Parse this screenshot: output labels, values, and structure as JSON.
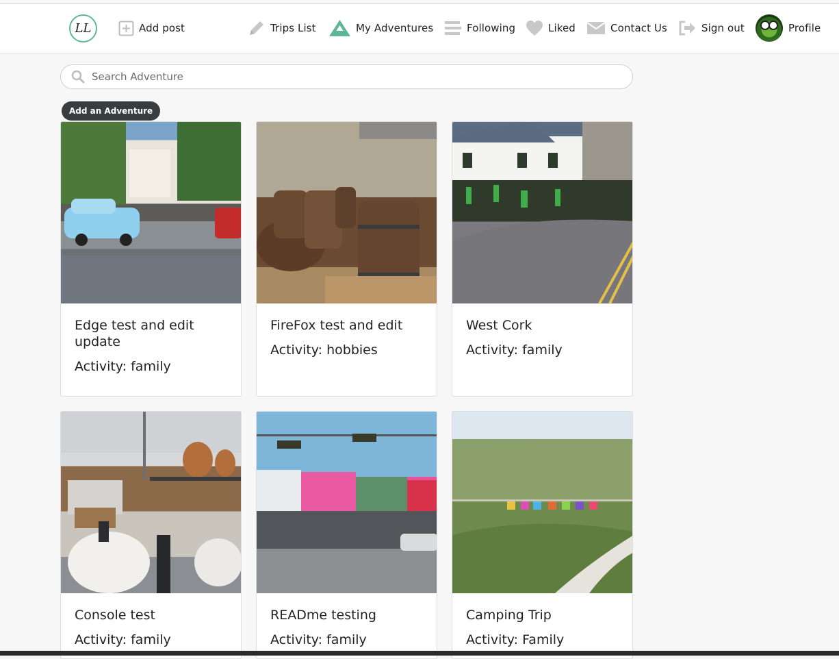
{
  "nav": {
    "logo_text": "LL",
    "add_post": "Add post",
    "trips_list": "Trips List",
    "my_adventures": "My Adventures",
    "following": "Following",
    "liked": "Liked",
    "contact_us": "Contact Us",
    "sign_out": "Sign out",
    "profile": "Profile"
  },
  "search": {
    "placeholder": "Search Adventure"
  },
  "add_adventure_label": "Add an Adventure",
  "cards": [
    {
      "title": "Edge test and edit update",
      "activity": "Activity: family",
      "image": "street-with-vintage-cars"
    },
    {
      "title": "FireFox test and edit",
      "activity": "Activity: hobbies",
      "image": "whiskey-barrels"
    },
    {
      "title": "West Cork",
      "activity": "Activity: family",
      "image": "parade-crowd-village"
    },
    {
      "title": "Console test",
      "activity": "Activity: family",
      "image": "distillery-interior"
    },
    {
      "title": "READme testing",
      "activity": "Activity: family",
      "image": "storefront-street"
    },
    {
      "title": "Camping Trip",
      "activity": "Activity: Family",
      "image": "grassy-dunes-camping"
    }
  ],
  "colors": {
    "accent": "#5fb59a",
    "button_dark": "#3a3d40",
    "icon_grey": "#c8c8c8"
  }
}
